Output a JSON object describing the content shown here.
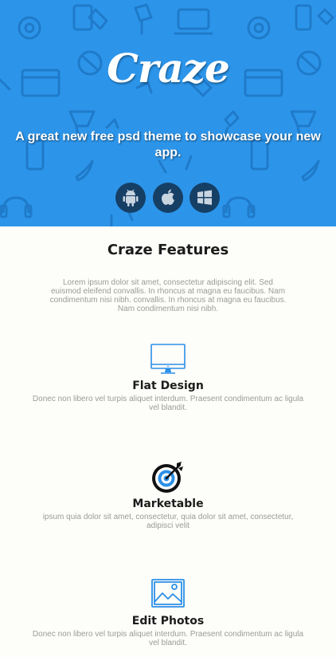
{
  "hero": {
    "logo": "Craze",
    "tagline": "A great new free psd theme to showcase your new app.",
    "background_color": "#2c95ea",
    "platforms": [
      {
        "name": "android",
        "icon": "android-icon"
      },
      {
        "name": "apple",
        "icon": "apple-icon"
      },
      {
        "name": "windows",
        "icon": "windows-icon"
      }
    ]
  },
  "features": {
    "title": "Craze Features",
    "intro": "Lorem ipsum dolor sit amet, consectetur adipiscing elit. Sed euismod eleifend convallis. In rhoncus at magna eu faucibus. Nam condimentum nisi nibh. convallis. In rhoncus at magna eu faucibus. Nam condimentum nisi nibh.",
    "items": [
      {
        "title": "Flat Design",
        "description": "Donec non libero vel turpis aliquet interdum. Praesent condimentum ac ligula vel blandit.",
        "icon": "monitor-icon"
      },
      {
        "title": "Marketable",
        "description": "ipsum quia dolor sit amet, consectetur, quia dolor sit amet, consectetur, adipisci velit",
        "icon": "target-icon"
      },
      {
        "title": "Edit Photos",
        "description": "Donec non libero vel turpis aliquet interdum. Praesent condimentum ac ligula vel blandit.",
        "icon": "image-icon"
      }
    ]
  }
}
